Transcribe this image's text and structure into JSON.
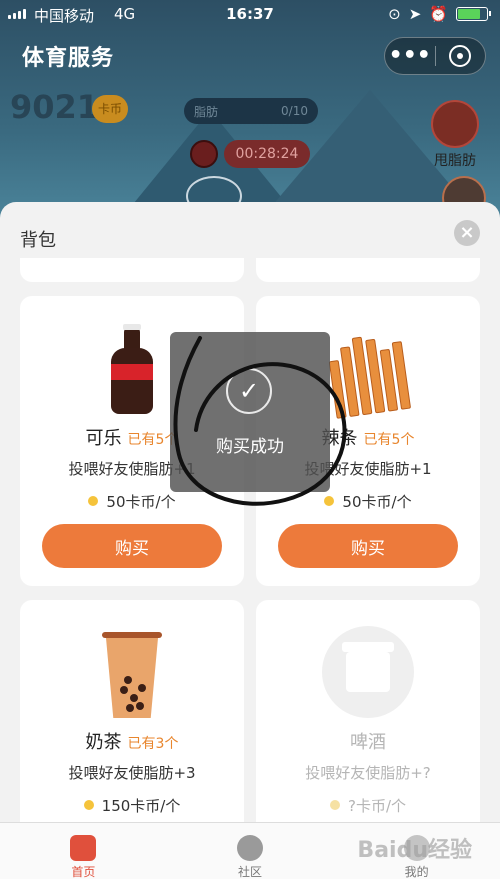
{
  "status_bar": {
    "carrier": "中国移动",
    "network": "4G",
    "time": "16:37",
    "battery_level": 0.8
  },
  "header": {
    "title": "体育服务",
    "more_icon": "ellipsis-icon",
    "close_icon": "miniprogram-exit-icon"
  },
  "game": {
    "coins": "9021",
    "coin_badge": "卡币",
    "fat_label": "脂肪",
    "fat_progress": "0/10",
    "timer": "00:28:24",
    "shake_label": "甩脂肪"
  },
  "backpack": {
    "title": "背包",
    "close_icon": "close-icon",
    "items": [
      {
        "name": "可乐",
        "owned": "已有5个",
        "desc": "投喂好友使脂肪+1",
        "price": "50卡币/个",
        "buy_label": "购买",
        "icon": "cola-bottle-icon"
      },
      {
        "name": "辣条",
        "owned": "已有5个",
        "desc": "投喂好友使脂肪+1",
        "price": "50卡币/个",
        "buy_label": "购买",
        "icon": "spicy-strips-icon"
      },
      {
        "name": "奶茶",
        "owned": "已有3个",
        "desc": "投喂好友使脂肪+3",
        "price": "150卡币/个",
        "buy_label": "",
        "icon": "milk-tea-icon"
      },
      {
        "name": "啤酒",
        "owned": "",
        "desc": "投喂好友使脂肪+?",
        "price": "?卡币/个",
        "buy_label": "",
        "icon": "gift-locked-icon"
      }
    ]
  },
  "toast": {
    "message": "购买成功",
    "icon": "check-circle-icon"
  },
  "tabbar": {
    "tabs": [
      {
        "label": "首页",
        "icon": "home-icon",
        "active": true
      },
      {
        "label": "社区",
        "icon": "chat-bubble-icon",
        "active": false
      },
      {
        "label": "我的",
        "icon": "profile-icon",
        "active": false
      }
    ]
  },
  "watermark": "Baidu经验",
  "colors": {
    "accent_orange": "#ed7a3b",
    "owned_orange": "#e8862e",
    "active_tab": "#e0503c",
    "sheet_bg": "#f2f2f2"
  }
}
